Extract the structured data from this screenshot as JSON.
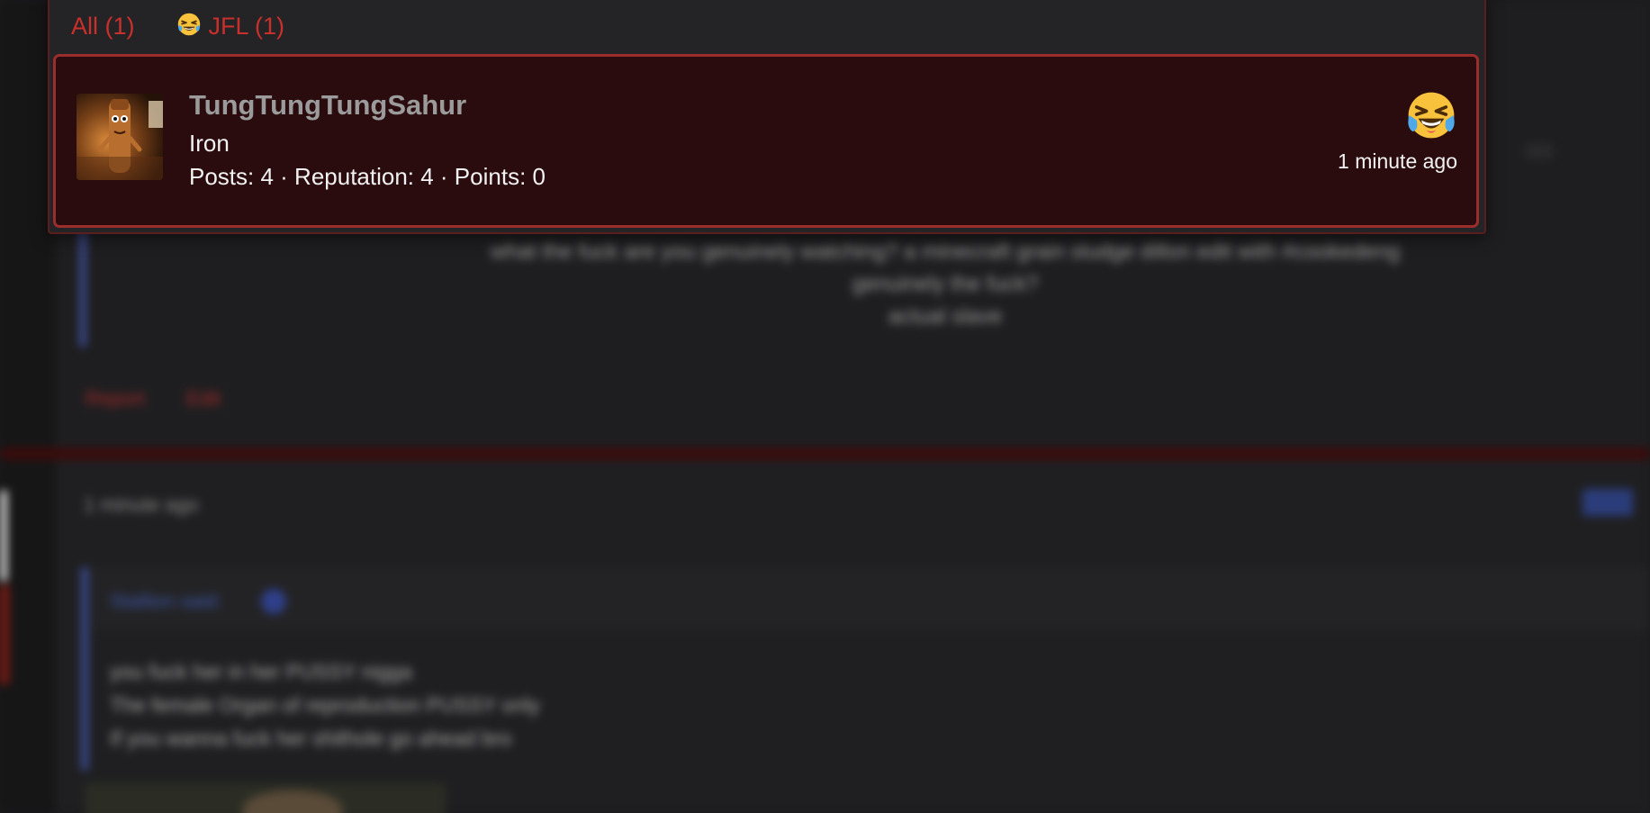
{
  "popup": {
    "tabs": [
      {
        "label": "All (1)",
        "emoji": ""
      },
      {
        "label": "JFL (1)",
        "emoji": "😹"
      }
    ],
    "reactions": [
      {
        "username": "TungTungTungSahur",
        "rank": "Iron",
        "stats": "Posts: 4 · Reputation: 4 · Points: 0",
        "reaction_icon": "laughing-crying-emoji-icon",
        "time": "1 minute ago"
      }
    ]
  },
  "background": {
    "post_text_lines": [
      "what the fuck are you genuinely watching? a minecraft grain sludge dillon edit with #cookedeng",
      "genuinely the fuck?",
      "actual slave"
    ],
    "actions": [
      "Report",
      "Edit"
    ],
    "time": "1 minute ago",
    "badge": "New",
    "quote_author": "Stallion said:",
    "quote_lines": [
      "you fuck her in her PUSSY nigga",
      "The female Organ of reproduction PUSSY only",
      "If you wanna fuck her shithole go ahead bro"
    ]
  },
  "colors": {
    "accent_red": "#c9302c",
    "card_border": "#9c2d2d",
    "card_bg": "#2a0c0f",
    "quote_blue": "#3b4a8f"
  }
}
